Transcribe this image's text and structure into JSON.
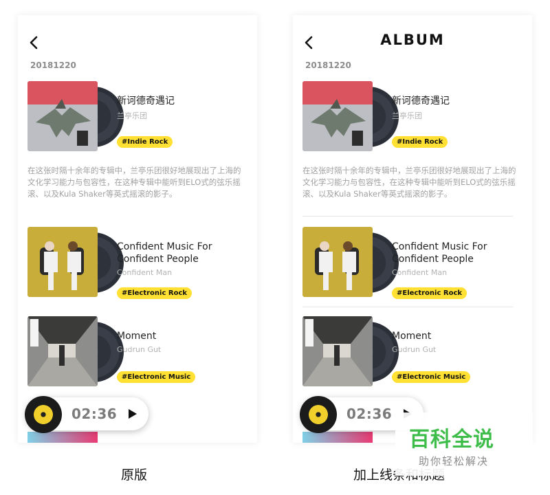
{
  "screens": [
    {
      "id": "original",
      "nav_title": "",
      "date": "20181220",
      "albums": [
        {
          "title_lines": [
            "新诃德奇遇记"
          ],
          "artist": "兰亭乐团",
          "tag": "#Indie Rock",
          "description": "在这张时隔十余年的专辑中，兰亭乐团很好地展现出了上海的文化学习能力与包容性，在这种专辑中能听到ELO式的弦乐摇滚、以及Kula Shaker等英式摇滚的影子。"
        },
        {
          "title_lines": [
            "Confident Music For",
            "Confident People"
          ],
          "artist": "Confident Man",
          "tag": "#Electronic Rock"
        },
        {
          "title_lines": [
            "Moment"
          ],
          "artist": "Gudrun Gut",
          "tag": "#Electronic Music"
        }
      ],
      "player": {
        "time": "02:36"
      },
      "caption": "原版"
    },
    {
      "id": "modified",
      "nav_title": "ALBUM",
      "date": "20181220",
      "albums": [
        {
          "title_lines": [
            "新诃德奇遇记"
          ],
          "artist": "兰亭乐团",
          "tag": "#Indie Rock",
          "description": "在这张时隔十余年的专辑中，兰亭乐团很好地展现出了上海的文化学习能力与包容性，在这种专辑中能听到ELO式的弦乐摇滚、以及Kula Shaker等英式摇滚的影子。"
        },
        {
          "title_lines": [
            "Confident Music For",
            "Confident People"
          ],
          "artist": "Confident Man",
          "tag": "#Electronic Rock"
        },
        {
          "title_lines": [
            "Moment"
          ],
          "artist": "Gudrun Gut",
          "tag": "#Electronic Music"
        }
      ],
      "player": {
        "time": "02:36"
      },
      "caption": "加上线条和标题"
    }
  ],
  "watermark": {
    "logo": "百科全说",
    "subtitle": "助你轻松解决"
  },
  "colors": {
    "tag_yellow": "#ffe033",
    "vinyl_dark": "#2e323b",
    "desc_gray": "#a0a0a0"
  },
  "icons": [
    "back-chevron-icon",
    "play-icon",
    "vinyl-disc-icon"
  ]
}
